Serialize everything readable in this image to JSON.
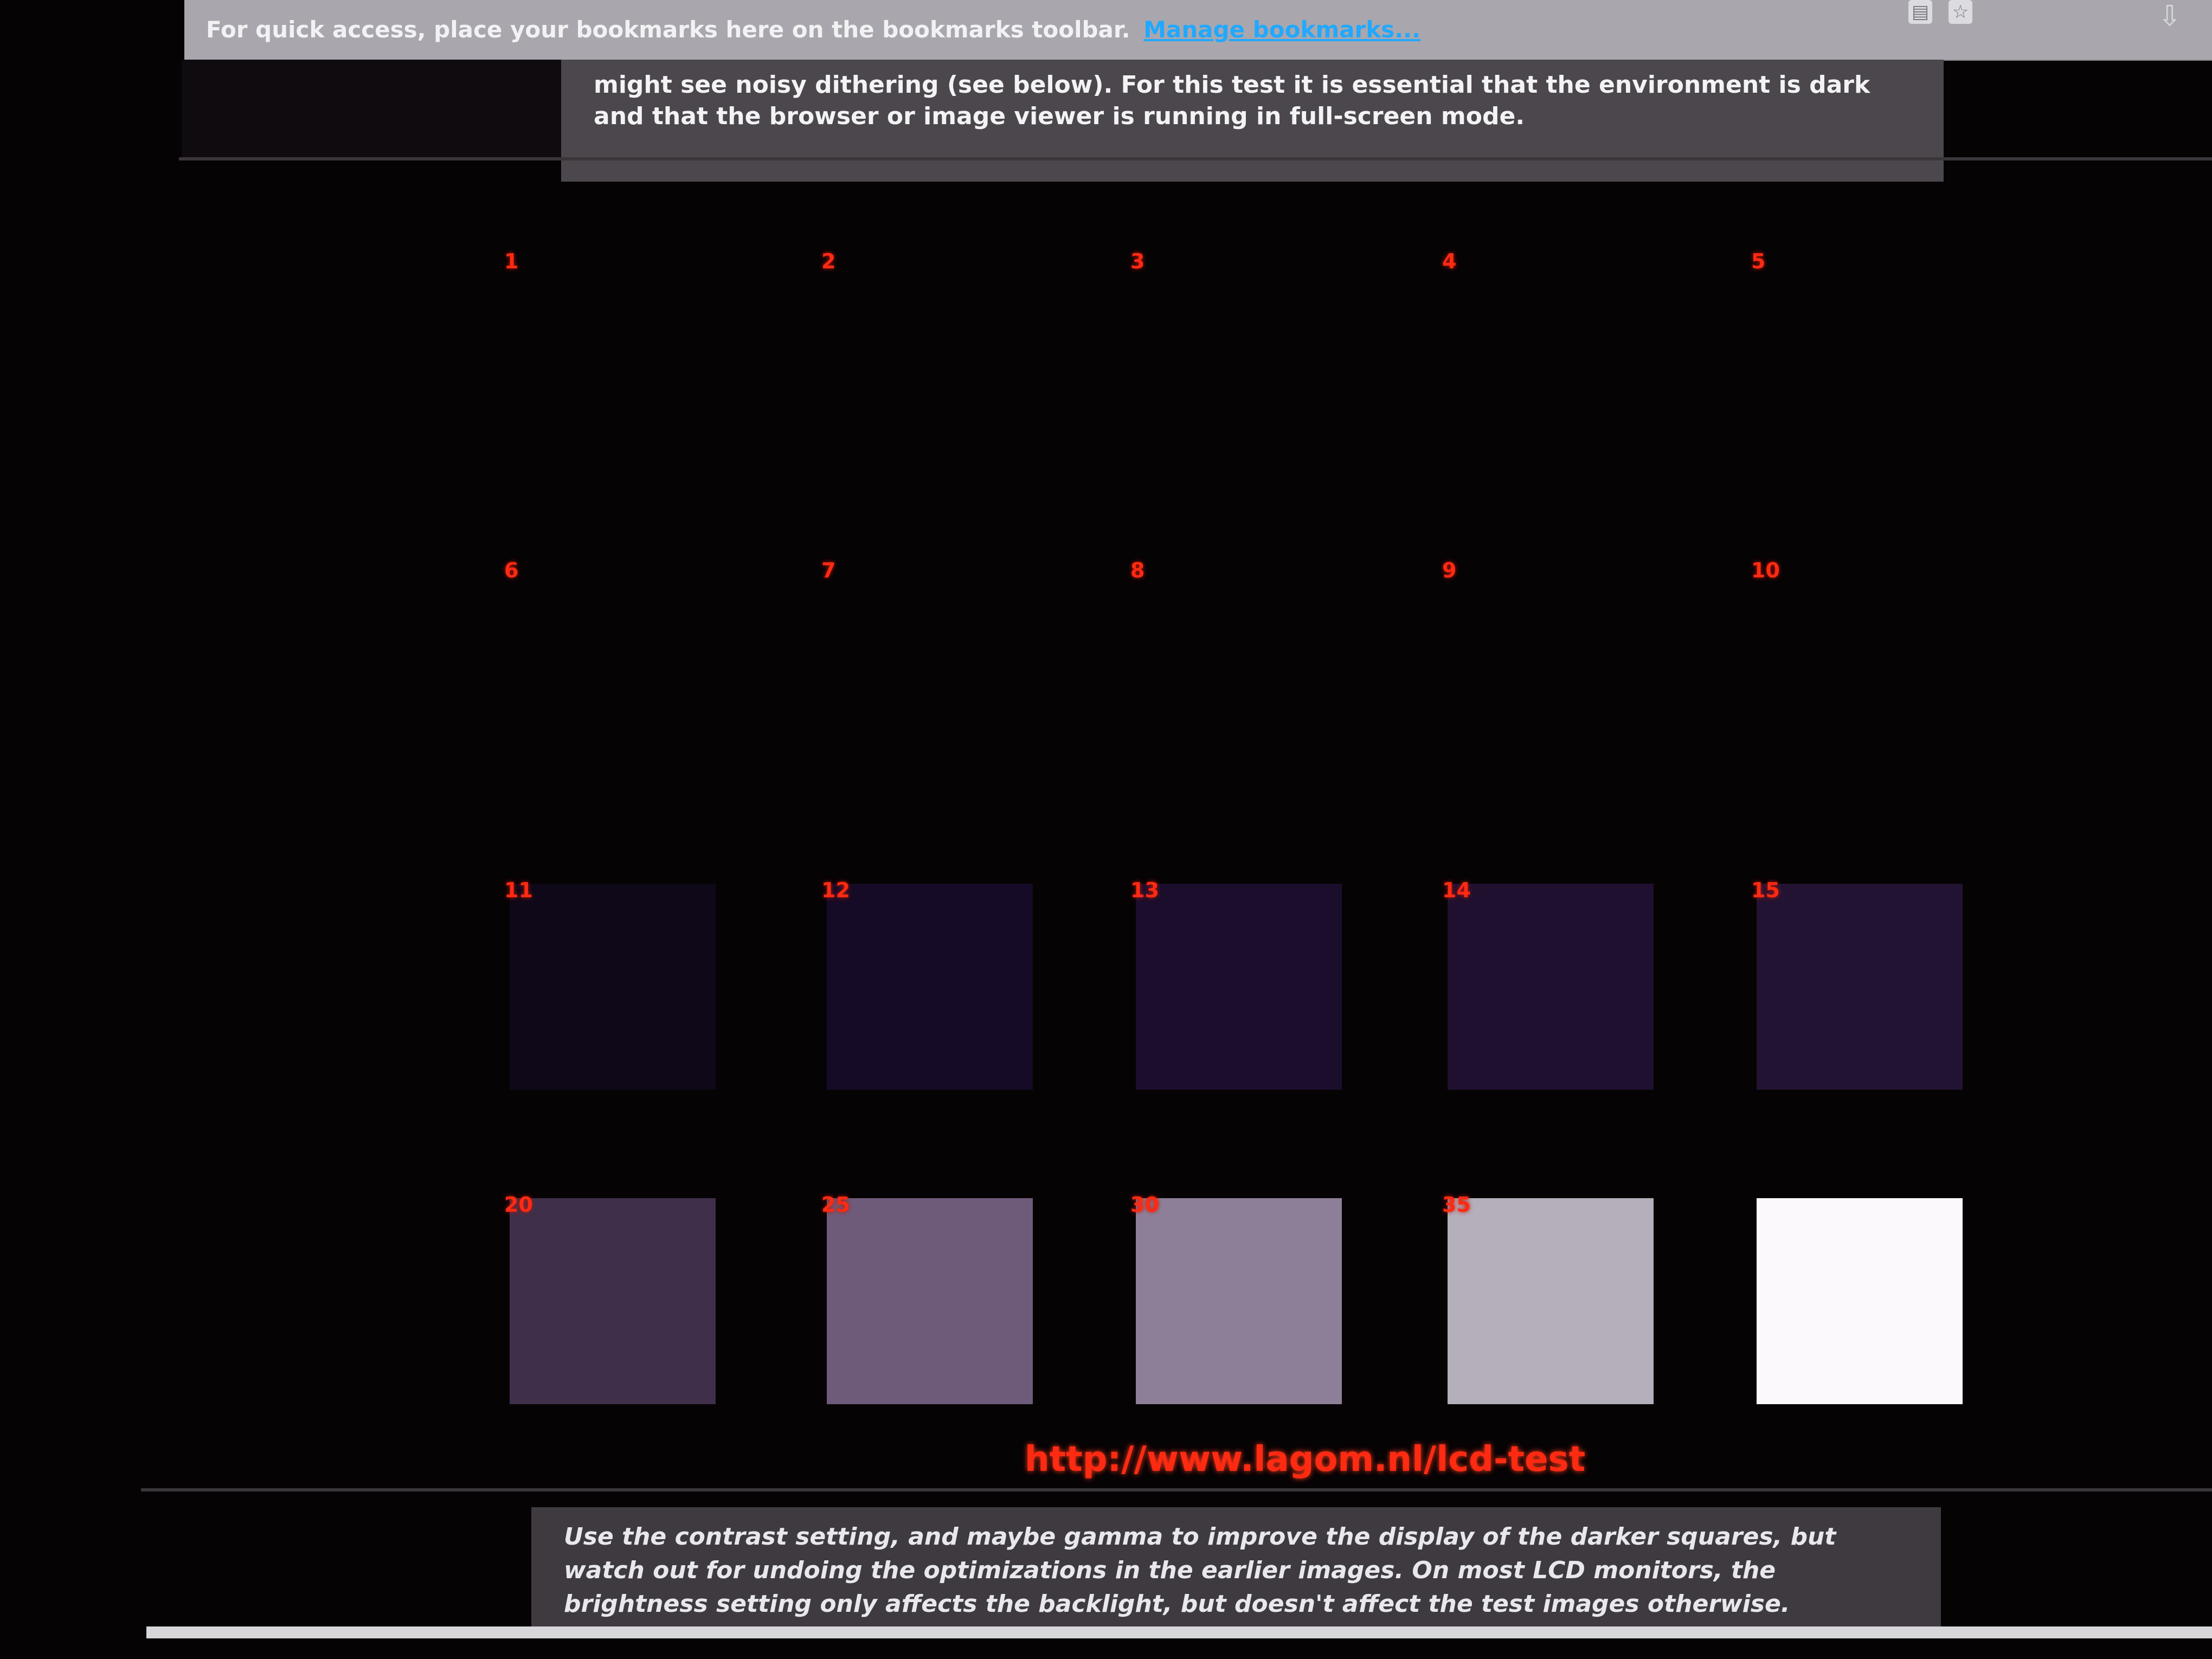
{
  "bookmarks_toolbar": {
    "message": "For quick access, place your bookmarks here on the bookmarks toolbar.",
    "manage_link": "Manage bookmarks...",
    "icons": [
      "reader-view-icon",
      "star-bookmark-icon",
      "download-icon"
    ]
  },
  "top_panel": {
    "text": "might see noisy dithering (see below). For this test it is essential that the environment is dark and that the browser or image viewer is running in full-screen mode."
  },
  "test_grid": {
    "cells": [
      {
        "number": "1",
        "color": "#060305"
      },
      {
        "number": "2",
        "color": "#060305"
      },
      {
        "number": "3",
        "color": "#060305"
      },
      {
        "number": "4",
        "color": "#060305"
      },
      {
        "number": "5",
        "color": "#060305"
      },
      {
        "number": "6",
        "color": "#060305"
      },
      {
        "number": "7",
        "color": "#060305"
      },
      {
        "number": "8",
        "color": "#060305"
      },
      {
        "number": "9",
        "color": "#060305"
      },
      {
        "number": "10",
        "color": "#060305"
      },
      {
        "number": "11",
        "color": "#0f0818"
      },
      {
        "number": "12",
        "color": "#160b26"
      },
      {
        "number": "13",
        "color": "#1b0e2c"
      },
      {
        "number": "14",
        "color": "#1f1030"
      },
      {
        "number": "15",
        "color": "#231332"
      },
      {
        "number": "20",
        "color": "#3f2f4a"
      },
      {
        "number": "25",
        "color": "#6e5b7a"
      },
      {
        "number": "30",
        "color": "#8e7f98"
      },
      {
        "number": "35",
        "color": "#b5aebb"
      },
      {
        "number": "",
        "color": "#fbf9fb"
      }
    ]
  },
  "url": "http://www.lagom.nl/lcd-test",
  "bottom_panel": {
    "text": "Use the contrast setting, and maybe gamma to improve the display of the darker squares, but watch out for undoing the optimizations in the earlier images. On most LCD monitors, the brightness setting only affects the backlight, but doesn't affect the test images otherwise."
  }
}
